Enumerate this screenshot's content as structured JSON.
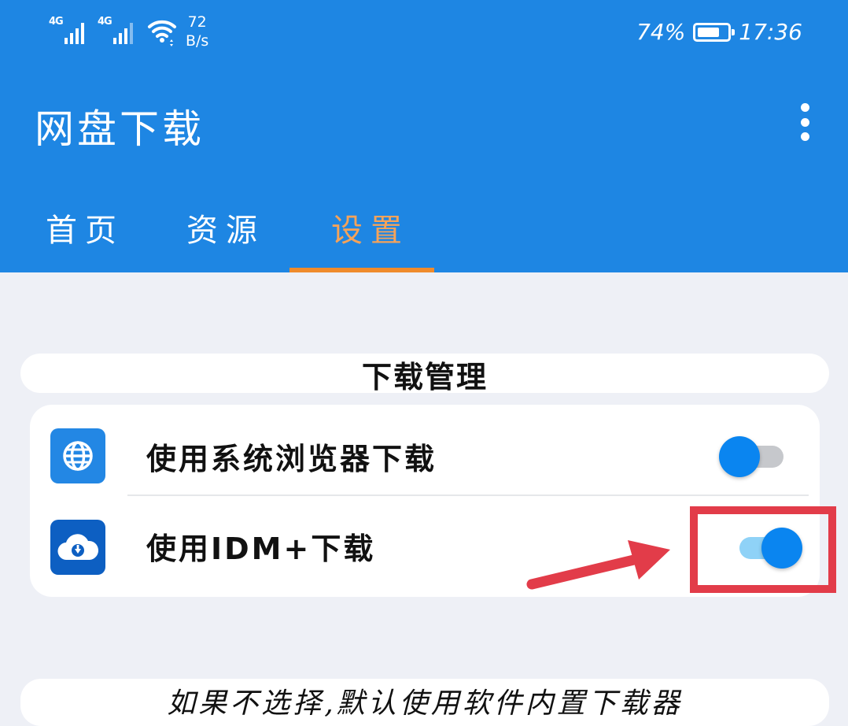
{
  "status_bar": {
    "signal_1_label": "4G",
    "signal_2_label": "4G",
    "net_speed_value": "72",
    "net_speed_unit": "B/s",
    "battery_percent": "74%",
    "battery_level": 0.74,
    "time": "17:36",
    "icons": [
      "signal-icon",
      "signal-icon",
      "wifi-icon",
      "battery-icon"
    ]
  },
  "app_bar": {
    "title": "网盘下载",
    "menu_icon": "more-vertical-icon"
  },
  "tabs": [
    {
      "label": "首页",
      "active": false
    },
    {
      "label": "资源",
      "active": false
    },
    {
      "label": "设置",
      "active": true
    }
  ],
  "settings": {
    "section_title": "下载管理",
    "items": [
      {
        "label": "使用系统浏览器下载",
        "icon": "globe-icon",
        "enabled": false
      },
      {
        "label": "使用IDM+下载",
        "icon": "cloud-download-icon",
        "enabled": true
      }
    ],
    "note": "如果不选择,默认使用软件内置下载器"
  },
  "colors": {
    "primary": "#1e86e3",
    "tab_active": "#f5a35a",
    "tab_indicator": "#ef8b2c",
    "switch_thumb": "#0a85f0",
    "switch_on_track": "#8fd2f7",
    "switch_off_track": "#c6c8cc",
    "annotation_red": "#e23c49",
    "background": "#eef0f6"
  }
}
